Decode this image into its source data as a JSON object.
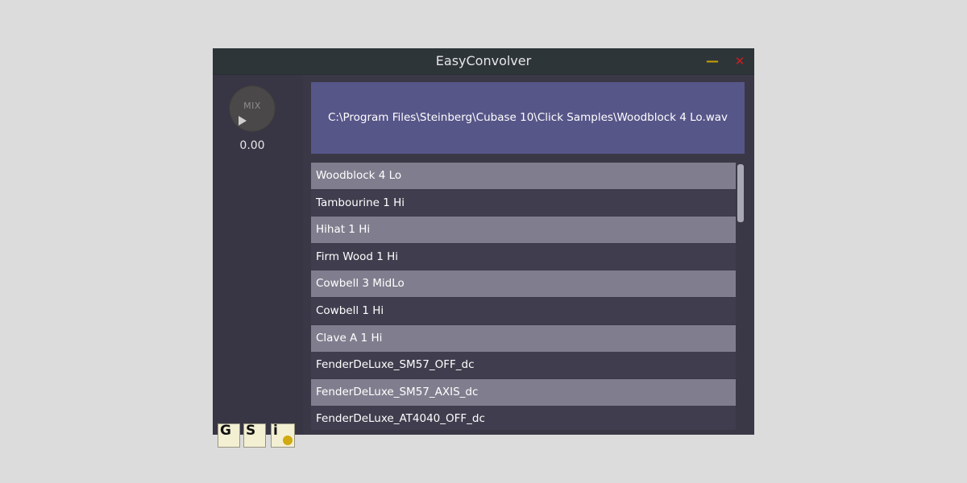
{
  "window": {
    "title": "EasyConvolver",
    "minimize_glyph": "—",
    "close_glyph": "✕"
  },
  "mix_knob": {
    "label": "MIX",
    "value": "0.00"
  },
  "icon_buttons": {
    "g_label": "G",
    "s_label": "S",
    "i_label": "i"
  },
  "file_path": "C:\\Program Files\\Steinberg\\Cubase 10\\Click Samples\\Woodblock 4 Lo.wav",
  "samples": [
    "Woodblock 4 Lo",
    "Tambourine 1 Hi",
    "Hihat 1 Hi",
    "Firm Wood 1 Hi",
    "Cowbell 3 MidLo",
    "Cowbell 1 Hi",
    "Clave A 1 Hi",
    "FenderDeLuxe_SM57_OFF_dc",
    "FenderDeLuxe_SM57_AXIS_dc",
    "FenderDeLuxe_AT4040_OFF_dc"
  ],
  "colors": {
    "path_panel": "#575689",
    "row_light": "#807e8e",
    "row_dark": "#403d4e",
    "minimize": "#c8a000",
    "close": "#c82020",
    "info_dot": "#d1a910"
  }
}
